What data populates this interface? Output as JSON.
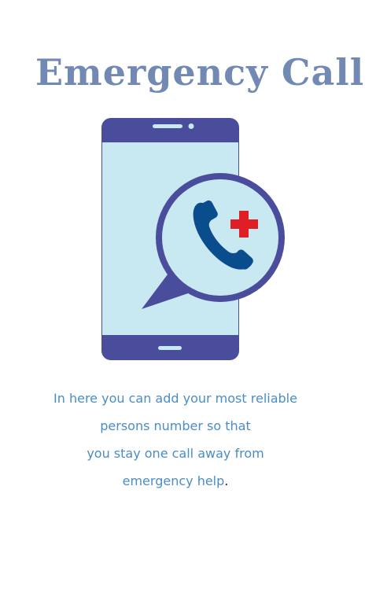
{
  "header": {
    "title": "Emergency Call"
  },
  "illustration": {
    "icons": [
      "smartphone-icon",
      "chat-bubble-icon",
      "phone-handset-icon",
      "medical-cross-icon"
    ],
    "colors": {
      "phone_body": "#4a4c9c",
      "phone_screen": "#c8e8f2",
      "handset": "#0a4d8c",
      "cross": "#e01e26"
    }
  },
  "description": {
    "lines": [
      "In here you can add your most reliable",
      "persons number so that",
      "you stay one call away from",
      "emergency help"
    ],
    "trailing_period": "."
  }
}
